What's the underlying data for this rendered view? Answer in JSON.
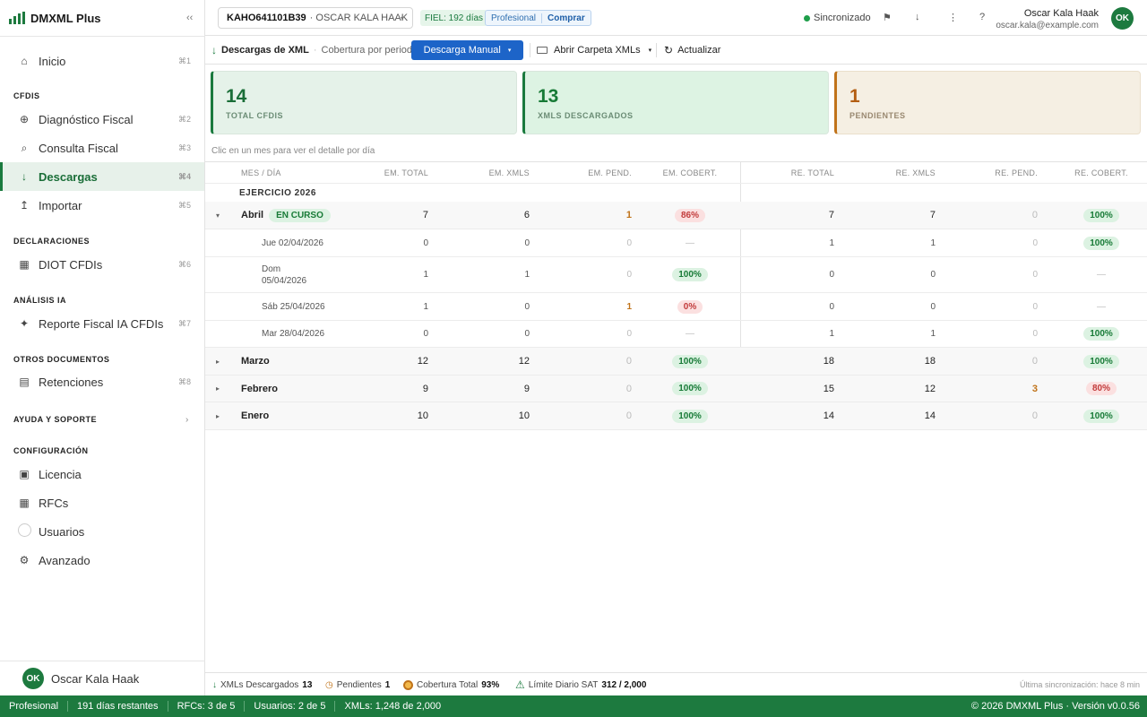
{
  "app": {
    "name": "DMXML Plus",
    "collapse_icon": "‹‹"
  },
  "sidebar": {
    "inicio": {
      "label": "Inicio",
      "shortcut": "⌘1"
    },
    "sections": {
      "cfdis": "CFDIS",
      "declaraciones": "DECLARACIONES",
      "analisis": "ANÁLISIS IA",
      "otros": "OTROS DOCUMENTOS",
      "ayuda": "AYUDA Y SOPORTE",
      "config": "CONFIGURACIÓN"
    },
    "items": {
      "diagnostico": {
        "label": "Diagnóstico Fiscal",
        "shortcut": "⌘2"
      },
      "consulta": {
        "label": "Consulta Fiscal",
        "shortcut": "⌘3"
      },
      "descargas": {
        "label": "Descargas",
        "shortcut": "⌘4"
      },
      "importar": {
        "label": "Importar",
        "shortcut": "⌘5"
      },
      "diot": {
        "label": "DIOT CFDIs",
        "shortcut": "⌘6"
      },
      "reporte": {
        "label": "Reporte Fiscal IA CFDIs",
        "shortcut": "⌘7"
      },
      "retenciones": {
        "label": "Retenciones",
        "shortcut": "⌘8"
      },
      "licencia": {
        "label": "Licencia"
      },
      "rfcs": {
        "label": "RFCs"
      },
      "usuarios": {
        "label": "Usuarios"
      },
      "avanzado": {
        "label": "Avanzado"
      }
    },
    "user": {
      "initials": "OK",
      "name": "Oscar Kala Haak"
    }
  },
  "header": {
    "rfc_code": "KAHO641101B39",
    "rfc_name": "· OSCAR KALA HAAK",
    "fiel": "FIEL: 192 días",
    "plan": "Profesional",
    "buy": "Comprar",
    "sync": "Sincronizado",
    "user_name": "Oscar Kala Haak",
    "user_email": "oscar.kala@example.com",
    "user_initials": "OK"
  },
  "toolbar": {
    "title": "Descargas de XML",
    "subtitle": "Cobertura por periodo",
    "manual": "Descarga Manual",
    "folder": "Abrir Carpeta XMLs",
    "refresh": "Actualizar"
  },
  "cards": [
    {
      "value": "14",
      "label": "TOTAL CFDIS"
    },
    {
      "value": "13",
      "label": "XMLS DESCARGADOS"
    },
    {
      "value": "1",
      "label": "PENDIENTES"
    }
  ],
  "hint": "Clic en un mes para ver el detalle por día",
  "table": {
    "headers": [
      "MES / DÍA",
      "EM. TOTAL",
      "EM. XMLS",
      "EM. PEND.",
      "EM. COBERT.",
      "RE. TOTAL",
      "RE. XMLS",
      "RE. PEND.",
      "RE. COBERT."
    ],
    "year": "EJERCICIO 2026",
    "badge": "EN CURSO",
    "rows": [
      {
        "label": "Abril",
        "emt": "7",
        "emx": "6",
        "emp": "1",
        "emc": "86%",
        "ret": "7",
        "rex": "7",
        "rep": "0",
        "rec": "100%"
      },
      {
        "label": "Jue 02/04/2026",
        "emt": "0",
        "emx": "0",
        "emp": "0",
        "emc": "—",
        "ret": "1",
        "rex": "1",
        "rep": "0",
        "rec": "100%"
      },
      {
        "label": "Dom",
        "label2": "05/04/2026",
        "emt": "1",
        "emx": "1",
        "emp": "0",
        "emc": "100%",
        "ret": "0",
        "rex": "0",
        "rep": "0",
        "rec": "—"
      },
      {
        "label": "Sáb 25/04/2026",
        "emt": "1",
        "emx": "0",
        "emp": "1",
        "emc": "0%",
        "ret": "0",
        "rex": "0",
        "rep": "0",
        "rec": "—"
      },
      {
        "label": "Mar 28/04/2026",
        "emt": "0",
        "emx": "0",
        "emp": "0",
        "emc": "—",
        "ret": "1",
        "rex": "1",
        "rep": "0",
        "rec": "100%"
      },
      {
        "label": "Marzo",
        "emt": "12",
        "emx": "12",
        "emp": "0",
        "emc": "100%",
        "ret": "18",
        "rex": "18",
        "rep": "0",
        "rec": "100%"
      },
      {
        "label": "Febrero",
        "emt": "9",
        "emx": "9",
        "emp": "0",
        "emc": "100%",
        "ret": "15",
        "rex": "12",
        "rep": "3",
        "rec": "80%"
      },
      {
        "label": "Enero",
        "emt": "10",
        "emx": "10",
        "emp": "0",
        "emc": "100%",
        "ret": "14",
        "rex": "14",
        "rep": "0",
        "rec": "100%"
      }
    ]
  },
  "stats": {
    "xmls_label": "XMLs Descargados",
    "xmls_value": "13",
    "pend_label": "Pendientes",
    "pend_value": "1",
    "cob_label": "Cobertura Total",
    "cob_value": "93%",
    "limit_label": "Límite Diario SAT",
    "limit_value": "312 / 2,000",
    "last_sync": "Última sincronización: hace 8 min"
  },
  "status": {
    "plan": "Profesional",
    "days": "191 días restantes",
    "rfcs": "RFCs: 3 de 5",
    "users": "Usuarios: 2 de 5",
    "xmls": "XMLs: 1,248 de 2,000",
    "copyright": "© 2026 DMXML Plus · Versión v0.0.56"
  },
  "colors": {
    "brand": "#1d7a3f",
    "primary": "#1d64c8",
    "warn": "#c0731a",
    "danger": "#c23b3b"
  }
}
